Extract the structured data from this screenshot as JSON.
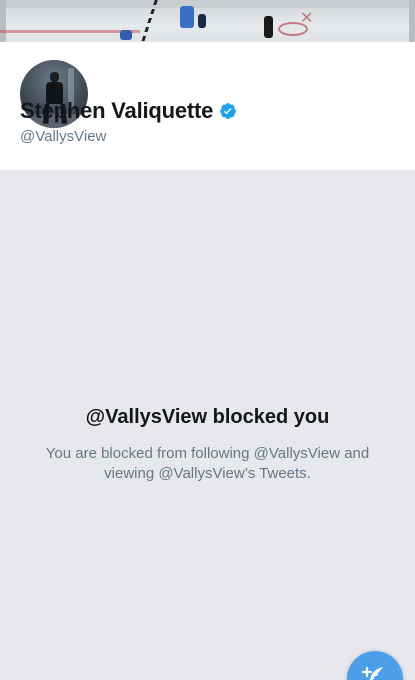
{
  "profile": {
    "display_name": "Stephen Valiquette",
    "handle": "@VallysView",
    "verified": true,
    "banner_icon": "hockey-rink-photo",
    "avatar_icon": "profile-photo"
  },
  "blocked": {
    "title": "@VallysView blocked you",
    "description": "You are blocked from following @VallysView and viewing @VallysView’s Tweets."
  },
  "compose": {
    "icon": "compose-tweet-icon",
    "color": "#4a9fe8"
  },
  "colors": {
    "background": "#e6e8ee",
    "verified": "#1da1f2",
    "secondary_text": "#657786"
  }
}
